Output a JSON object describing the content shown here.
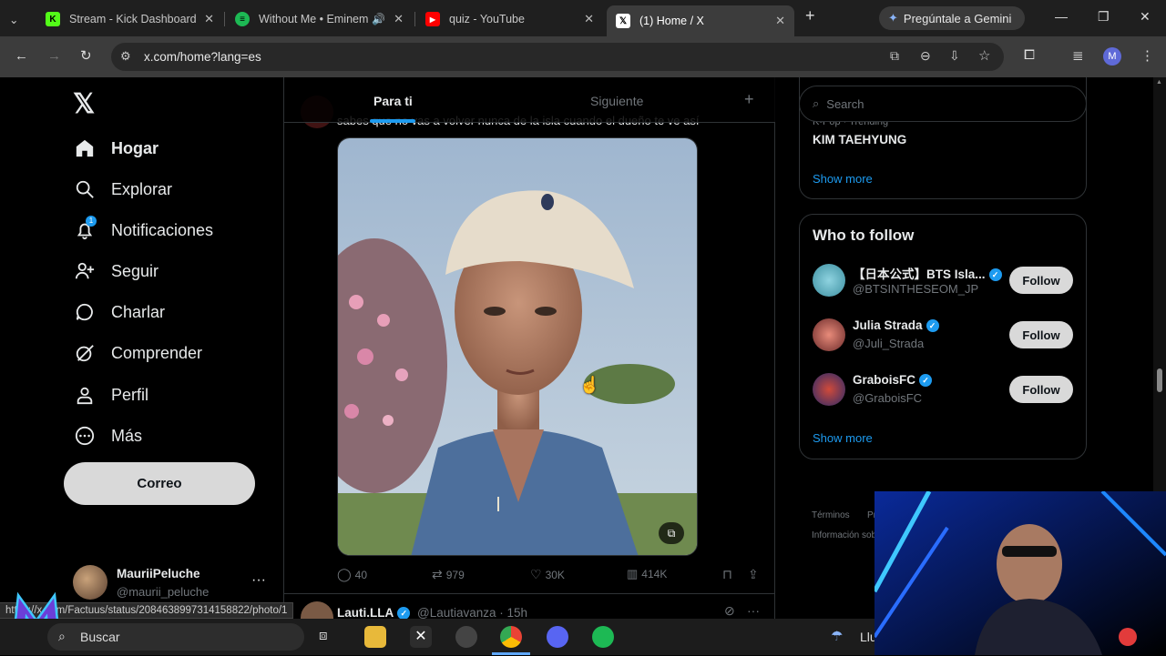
{
  "browser": {
    "tabs": [
      {
        "title": "Stream - Kick Dashboard",
        "favicon": "kick-icon",
        "color": "#53fc18"
      },
      {
        "title": "Without Me • Eminem",
        "favicon": "spotify-icon",
        "color": "#1db954"
      },
      {
        "title": "quiz - YouTube",
        "favicon": "youtube-icon",
        "color": "#ff0000"
      },
      {
        "title": "(1) Home / X",
        "favicon": "x-icon",
        "color": "#ffffff"
      }
    ],
    "gemini_label": "Pregúntale a Gemini",
    "url": "x.com/home?lang=es",
    "profile_initial": "M"
  },
  "sidebar": {
    "items": [
      {
        "label": "Hogar",
        "icon": "home-icon"
      },
      {
        "label": "Explorar",
        "icon": "search-icon"
      },
      {
        "label": "Notificaciones",
        "icon": "bell-icon",
        "badge": "1"
      },
      {
        "label": "Seguir",
        "icon": "follow-icon"
      },
      {
        "label": "Charlar",
        "icon": "chat-icon"
      },
      {
        "label": "Comprender",
        "icon": "grok-icon"
      },
      {
        "label": "Perfil",
        "icon": "profile-icon"
      },
      {
        "label": "Más",
        "icon": "more-icon"
      }
    ],
    "post_button": "Correo",
    "account": {
      "name": "MauriiPeluche",
      "handle": "@maurii_peluche"
    }
  },
  "feed": {
    "tabs": [
      "Para ti",
      "Siguiente"
    ],
    "active_tab": "Para ti",
    "post_text_cut": "sabes que no vas a volver nunca de la isla cuando el dueño te ve así",
    "actions": {
      "replies": "40",
      "reposts": "979",
      "likes": "30K",
      "views": "414K"
    },
    "next_post": {
      "name": "Lauti.LLA",
      "handle": "@Lautiavanza",
      "time": "· 15h"
    }
  },
  "right": {
    "search_placeholder": "Search",
    "trending": {
      "meta": "K-Pop · Trending",
      "topic": "KIM TAEHYUNG",
      "show_more": "Show more"
    },
    "who_to_follow": {
      "title": "Who to follow",
      "accounts": [
        {
          "name": "【日本公式】BTS Isla...",
          "handle": "@BTSINTHESEOM_JP",
          "button": "Follow"
        },
        {
          "name": "Julia Strada",
          "handle": "@Juli_Strada",
          "button": "Follow"
        },
        {
          "name": "GraboisFC",
          "handle": "@GraboisFC",
          "button": "Follow"
        }
      ],
      "show_more": "Show more"
    },
    "footer": [
      "Términos",
      "Pr",
      "Información sob"
    ]
  },
  "status_url": "https://x.com/Factuus/status/2084638997314158822/photo/1",
  "taskbar": {
    "search_label": "Buscar",
    "weather_text": "Llu"
  }
}
